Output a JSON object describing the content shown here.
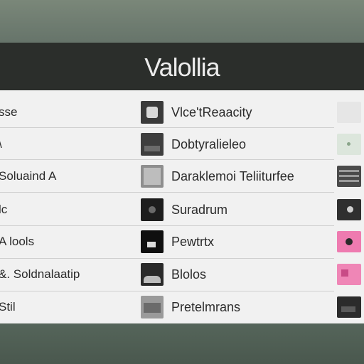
{
  "header": {
    "title": "Valollia"
  },
  "rows": [
    {
      "left": "sse",
      "mid": "Vlce'tReaacity"
    },
    {
      "left": "\\",
      "mid": "Dobtyralieleo"
    },
    {
      "left": "Soluaind A",
      "mid": "Daraklemoi Teliiturfee"
    },
    {
      "left": "lc",
      "mid": "Suradrum"
    },
    {
      "left": "A lools",
      "mid": "Pewtrtx"
    },
    {
      "left": "&. Soldnalaatip",
      "mid": "Blolos"
    },
    {
      "left": "Stil",
      "mid": "Pretelmrans"
    }
  ],
  "colors": {
    "background": "#5f6e60",
    "header": "#2b2e2b",
    "list": "#f1f1f1",
    "accent_pink": "#ee7bb0"
  }
}
